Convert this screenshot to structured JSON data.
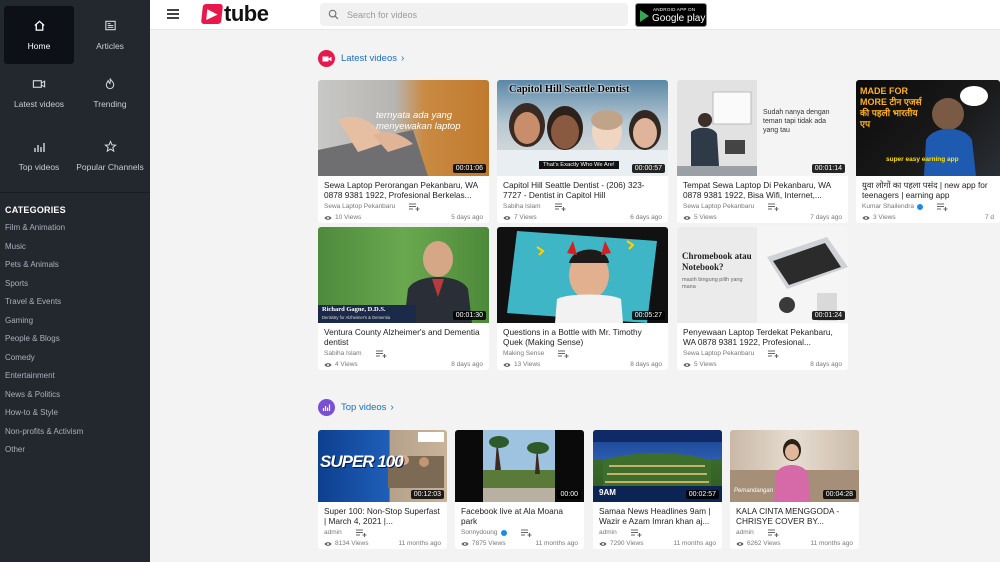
{
  "sidebar": {
    "nav": [
      {
        "label": "Home",
        "icon": "home-icon",
        "active": true
      },
      {
        "label": "Articles",
        "icon": "articles-icon"
      },
      {
        "label": "Latest videos",
        "icon": "camera-icon"
      },
      {
        "label": "Trending",
        "icon": "flame-icon"
      },
      {
        "label": "Top videos",
        "icon": "bar-chart-icon"
      },
      {
        "label": "Popular Channels",
        "icon": "star-icon"
      }
    ],
    "categories_title": "CATEGORIES",
    "categories": [
      "Film & Animation",
      "Music",
      "Pets & Animals",
      "Sports",
      "Travel & Events",
      "Gaming",
      "People & Blogs",
      "Comedy",
      "Entertainment",
      "News & Politics",
      "How-to & Style",
      "Non-profits & Activism",
      "Other"
    ]
  },
  "header": {
    "logo_mark": "▶",
    "logo_text": "tube",
    "search_placeholder": "Search for videos",
    "play_line1": "ANDROID APP ON",
    "play_line2": "Google play"
  },
  "latest": {
    "title": "Latest videos",
    "chevron": "›",
    "videos": [
      {
        "title": "Sewa Laptop Perorangan Pekanbaru, WA 0878 9381 1922, Profesional Berkelas...",
        "channel": "Sewa Laptop Pekanbaru",
        "views": "10 Views",
        "age": "5 days ago",
        "duration": "00:01:06",
        "thumb_text": "ternyata ada yang menyewakan laptop"
      },
      {
        "title": "Capitol Hill Seattle Dentist - (206) 323-7727 - Dentist in Capitol Hill",
        "channel": "Sabiha Islam",
        "views": "7 Views",
        "age": "6 days ago",
        "duration": "00:00:57",
        "thumb_text": "Capitol Hill Seattle Dentist",
        "thumb_sub": "That's Exactly Who We Are!"
      },
      {
        "title": "Tempat Sewa Laptop Di Pekanbaru, WA 0878 9381 1922, Bisa Wifi, Internet,...",
        "channel": "Sewa Laptop Pekanbaru",
        "views": "5 Views",
        "age": "7 days ago",
        "duration": "00:01:14",
        "thumb_text": "Sudah nanya dengan teman tapi tidak ada yang tau"
      },
      {
        "title": "युवा लोगों का पहला पसंद | new app for teenagers | earning app",
        "channel": "Kumar Shailendra",
        "verified": true,
        "views": "3 Views",
        "age": "7 d",
        "duration": "",
        "thumb_text": "MADE FOR MORE टीन एजर्स की पहली भारतीय एप",
        "thumb_sub": "super easy earning app"
      },
      {
        "title": "Ventura County Alzheimer's and Dementia dentist",
        "channel": "Sabiha Islam",
        "views": "4 Views",
        "age": "8 days ago",
        "duration": "00:01:30",
        "thumb_text": "Richard Gagne, D.D.S.",
        "thumb_sub": "Dentistry for Alzheimer's & Dementia"
      },
      {
        "title": "Questions in a Bottle with Mr. Timothy Quek (Making Sense)",
        "channel": "Making Sense",
        "views": "13 Views",
        "age": "8 days ago",
        "duration": "00:05:27",
        "thumb_text": ""
      },
      {
        "title": "Penyewaan Laptop Terdekat Pekanbaru, WA 0878 9381 1922, Profesional...",
        "channel": "Sewa Laptop Pekanbaru",
        "views": "5 Views",
        "age": "8 days ago",
        "duration": "00:01:24",
        "thumb_text": "Chromebook atau Notebook?",
        "thumb_sub": "masih bingung pilih yang mana"
      }
    ]
  },
  "top": {
    "title": "Top videos",
    "chevron": "›",
    "videos": [
      {
        "title": "Super 100: Non-Stop Superfast | March 4, 2021 |...",
        "channel": "admin",
        "views": "8134 Views",
        "age": "11 months ago",
        "duration": "00:12:03",
        "thumb_text": "SUPER 100"
      },
      {
        "title": "Facebook live at Ala Moana park",
        "channel": "Sonnydoung",
        "verified": true,
        "views": "7875 Views",
        "age": "11 months ago",
        "duration": "00:00",
        "thumb_text": ""
      },
      {
        "title": "Samaa News Headlines 9am | Wazir e Azam Imran khan aj...",
        "channel": "admin",
        "views": "7290 Views",
        "age": "11 months ago",
        "duration": "00:02:57",
        "thumb_text": "9AM"
      },
      {
        "title": "KALA CINTA MENGGODA - CHRISYE COVER BY...",
        "channel": "admin",
        "views": "6262 Views",
        "age": "11 months ago",
        "duration": "00:04:28",
        "thumb_text": "Pemandangan"
      }
    ]
  },
  "colors": {
    "sidebar": "#23272e",
    "accent_red": "#e8174c",
    "link_blue": "#1a6fc4",
    "top_badge": "#7a4fd4"
  }
}
